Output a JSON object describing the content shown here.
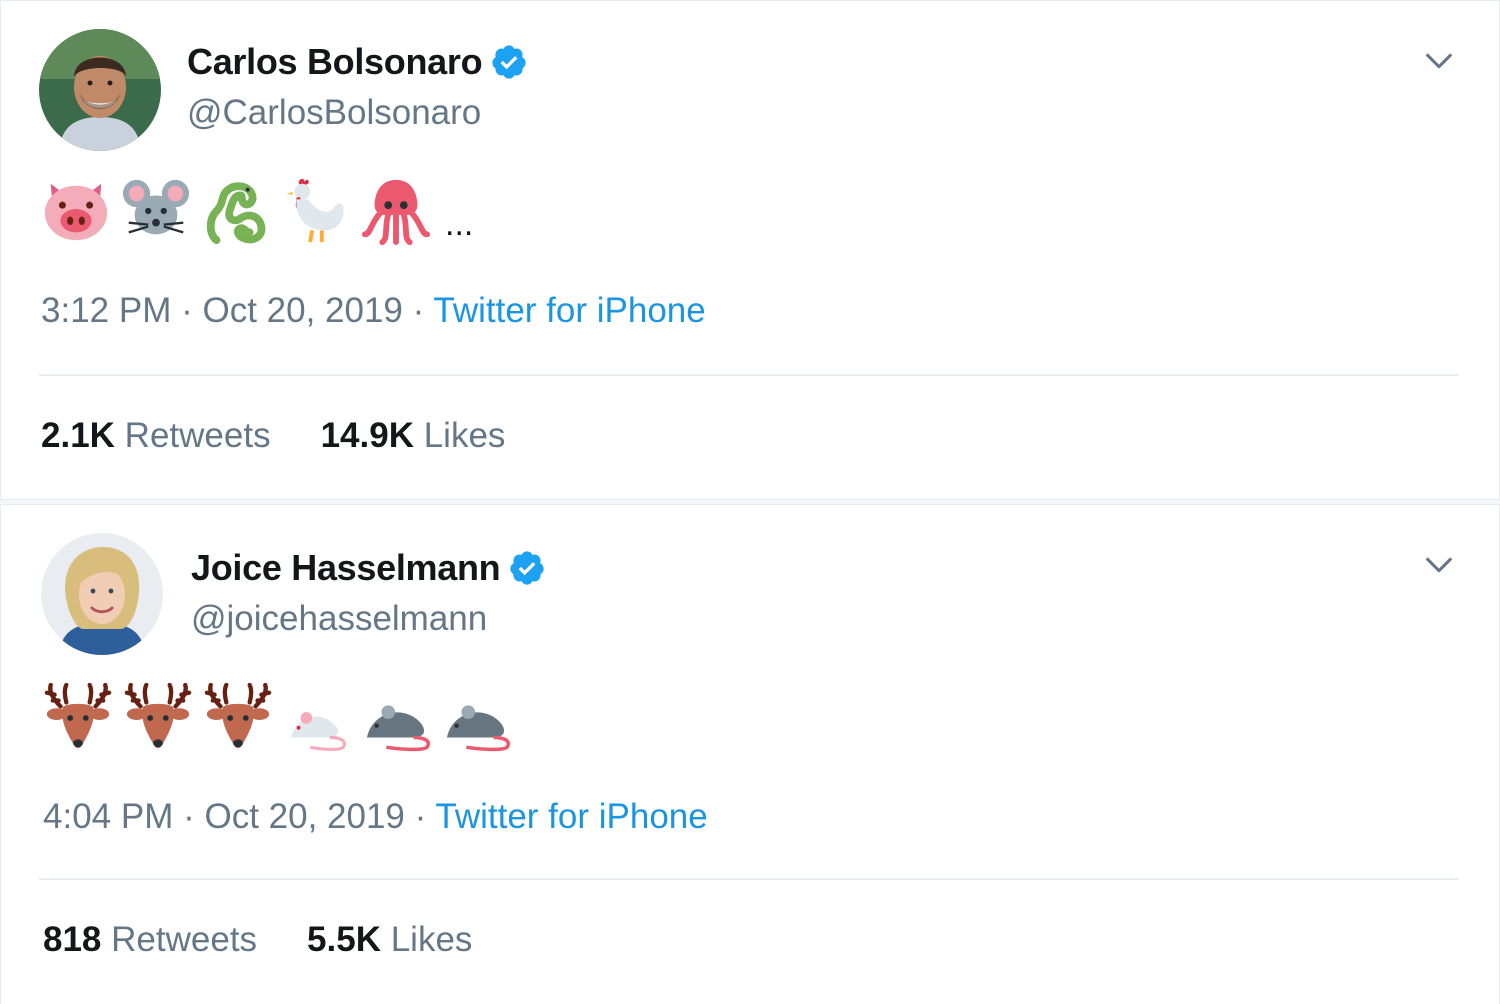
{
  "tweets": [
    {
      "display_name": "Carlos Bolsonaro",
      "handle": "@CarlosBolsonaro",
      "emojis": [
        "pig-face",
        "mouse-face",
        "snake",
        "rooster",
        "squid"
      ],
      "trailing_text": "...",
      "time": "3:12 PM",
      "separator": "·",
      "date": "Oct 20, 2019",
      "source": "Twitter for iPhone",
      "retweets_count": "2.1K",
      "retweets_label": "Retweets",
      "likes_count": "14.9K",
      "likes_label": "Likes"
    },
    {
      "display_name": "Joice Hasselmann",
      "handle": "@joicehasselmann",
      "emojis": [
        "deer",
        "deer",
        "deer",
        "white-mouse",
        "rat",
        "rat"
      ],
      "time": "4:04 PM",
      "separator": "·",
      "date": "Oct 20, 2019",
      "source": "Twitter for iPhone",
      "retweets_count": "818",
      "retweets_label": "Retweets",
      "likes_count": "5.5K",
      "likes_label": "Likes"
    }
  ],
  "colors": {
    "verified_badge": "#1da1f2",
    "link": "#1b95e0",
    "secondary_text": "#657786",
    "divider": "#e6ecf0"
  },
  "icons": {
    "verified": "verified-badge-icon",
    "menu": "chevron-down-icon"
  }
}
